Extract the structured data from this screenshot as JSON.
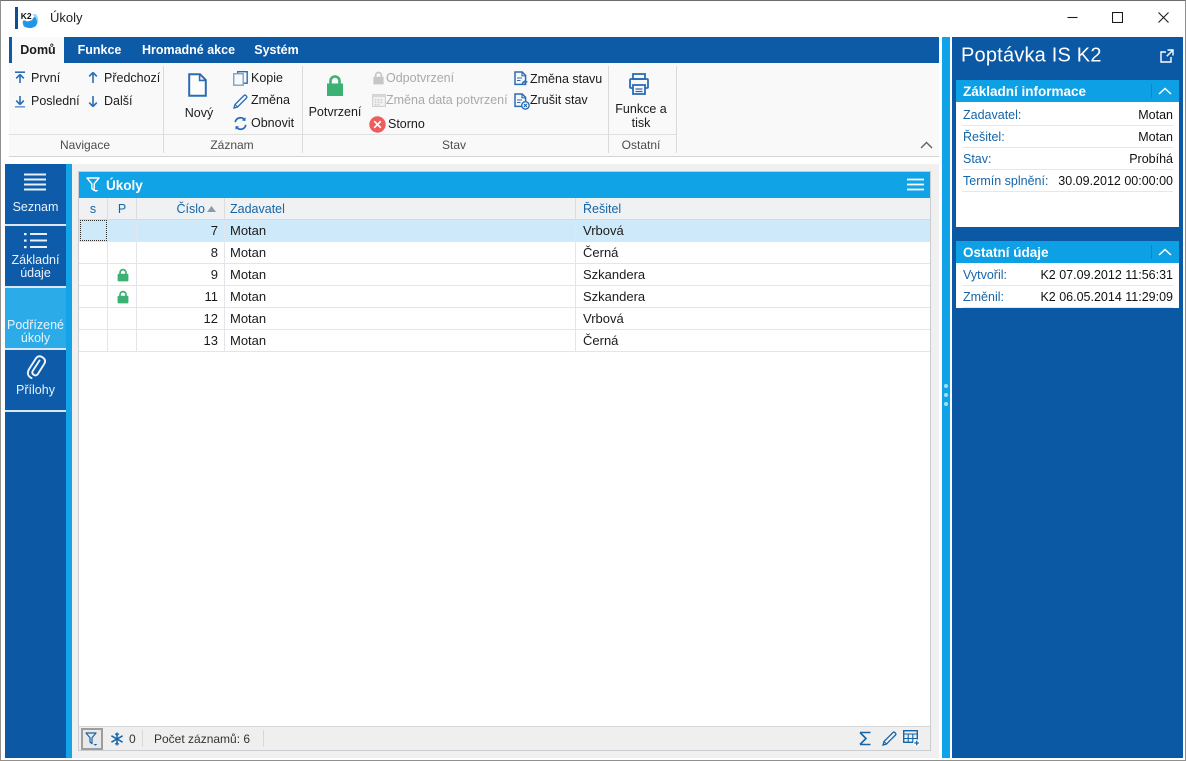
{
  "window": {
    "title": "Úkoly",
    "controls": {
      "minimize": "minimize",
      "maximize": "maximize",
      "close": "close"
    }
  },
  "tabs": {
    "items": [
      {
        "label": "Domů",
        "active": true
      },
      {
        "label": "Funkce",
        "active": false
      },
      {
        "label": "Hromadné akce",
        "active": false
      },
      {
        "label": "Systém",
        "active": false
      }
    ]
  },
  "ribbon": {
    "collapse_icon": "chevron-up",
    "groups": [
      {
        "label": "Navigace",
        "buttons": [
          {
            "label": "První",
            "icon": "arrow-up-to-bar"
          },
          {
            "label": "Poslední",
            "icon": "arrow-down-to-bar"
          },
          {
            "label": "Předchozí",
            "icon": "arrow-up"
          },
          {
            "label": "Další",
            "icon": "arrow-down"
          }
        ]
      },
      {
        "label": "Záznam",
        "big_button": {
          "label": "Nový",
          "icon": "new-document"
        },
        "buttons": [
          {
            "label": "Kopie",
            "icon": "copy"
          },
          {
            "label": "Změna",
            "icon": "pencil"
          },
          {
            "label": "Obnovit",
            "icon": "refresh"
          }
        ]
      },
      {
        "label": "Stav",
        "big_button": {
          "label": "Potvrzení",
          "icon": "lock-green"
        },
        "buttons": [
          {
            "label": "Odpotvrzení",
            "icon": "lock-gray",
            "disabled": true
          },
          {
            "label": "Změna data potvrzení",
            "icon": "calendar",
            "disabled": true
          },
          {
            "label": "Storno",
            "icon": "cancel-red",
            "disabled": false
          },
          {
            "label": "Změna stavu",
            "icon": "document-arrow",
            "disabled": false
          },
          {
            "label": "Zrušit stav",
            "icon": "document-x",
            "disabled": false
          }
        ]
      },
      {
        "label": "Ostatní",
        "big_button": {
          "label_line1": "Funkce a",
          "label_line2": "tisk",
          "icon": "printer"
        }
      }
    ]
  },
  "sidebar": {
    "items": [
      {
        "label": "Seznam",
        "icon": "list-icon",
        "active": false
      },
      {
        "label_line1": "Základní",
        "label_line2": "údaje",
        "icon": "detail-list-icon",
        "active": false
      },
      {
        "label_line1": "Podřízené",
        "label_line2": "úkoly",
        "icon": "",
        "active": true
      },
      {
        "label": "Přílohy",
        "icon": "paperclip-icon",
        "active": false
      }
    ]
  },
  "table": {
    "title": "Úkoly",
    "title_icon": "filter-funnel",
    "menu_icon": "hamburger",
    "columns": {
      "c0": "s",
      "c1": "P",
      "c2": "Číslo",
      "c3": "Zadavatel",
      "c4": "Řešitel"
    },
    "sort": {
      "column": "Číslo",
      "direction": "ascending"
    },
    "rows": [
      {
        "cislo": "7",
        "zadavatel": "Motan",
        "resitel": "Vrbová",
        "selected": true,
        "locked": false
      },
      {
        "cislo": "8",
        "zadavatel": "Motan",
        "resitel": "Černá",
        "selected": false,
        "locked": false
      },
      {
        "cislo": "9",
        "zadavatel": "Motan",
        "resitel": "Szkandera",
        "selected": false,
        "locked": true
      },
      {
        "cislo": "11",
        "zadavatel": "Motan",
        "resitel": "Szkandera",
        "selected": false,
        "locked": true
      },
      {
        "cislo": "12",
        "zadavatel": "Motan",
        "resitel": "Vrbová",
        "selected": false,
        "locked": false
      },
      {
        "cislo": "13",
        "zadavatel": "Motan",
        "resitel": "Černá",
        "selected": false,
        "locked": false
      }
    ],
    "status": {
      "filter_icon": "filter-funnel",
      "snowflake_icon": "snowflake",
      "snowflake_count": "0",
      "records_label": "Počet záznamů: 6",
      "right_icons": [
        "sigma",
        "pencil",
        "table-edit"
      ]
    }
  },
  "right_panel": {
    "title": "Poptávka IS K2",
    "open_icon": "external-link",
    "sections": [
      {
        "title": "Základní informace",
        "collapse_icon": "chevron-up",
        "rows": [
          {
            "label": "Zadavatel:",
            "value": "Motan"
          },
          {
            "label": "Řešitel:",
            "value": "Motan"
          },
          {
            "label": "Stav:",
            "value": "Probíhá"
          },
          {
            "label": "Termín splnění:",
            "value": "30.09.2012 00:00:00"
          }
        ]
      },
      {
        "title": "Ostatní údaje",
        "collapse_icon": "chevron-up",
        "rows": [
          {
            "label": "Vytvořil:",
            "value": "K2 07.09.2012 11:56:31"
          },
          {
            "label": "Změnil:",
            "value": "K2 06.05.2014 11:29:09"
          }
        ]
      }
    ]
  },
  "colors": {
    "dark_blue": "#0b58a5",
    "bright_blue": "#10a3e5",
    "active_tile_blue": "#2bace9",
    "ribbon_icon_blue": "#2a6cb5",
    "link_blue": "#1565a8",
    "selected_row": "#cee9f9",
    "green_lock": "#3bb273",
    "red_storno": "#ee5c5c"
  }
}
